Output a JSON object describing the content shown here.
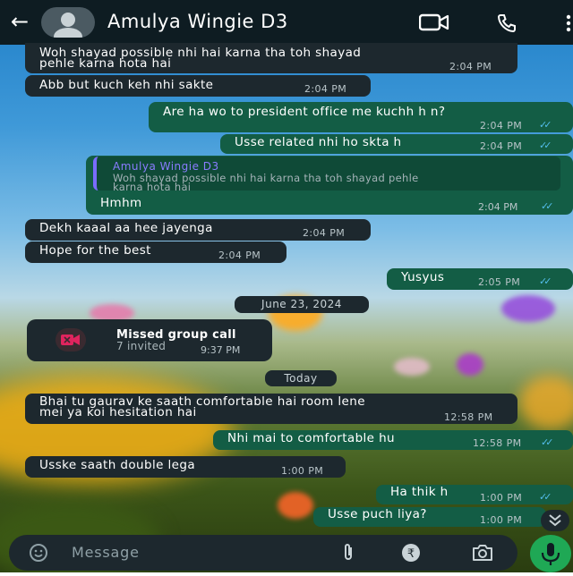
{
  "header": {
    "title": "Amulya Wingie D3",
    "back_icon": "arrow-left-icon",
    "video_icon": "video-call-icon",
    "call_icon": "phone-icon",
    "menu_icon": "more-vert-icon",
    "background": "#0e1c22"
  },
  "colors": {
    "incoming": "#1d282e",
    "outgoing": "#135d45",
    "read_ticks": "#53bdeb",
    "mic": "#1fa855"
  },
  "messages": [
    {
      "dir": "in",
      "text": "Woh shayad possible nhi hai karna tha toh shayad",
      "text2": "pehle karna hota hai",
      "time": "2:04 PM"
    },
    {
      "dir": "in",
      "text": "Abb but kuch keh nhi sakte",
      "time": "2:04 PM"
    },
    {
      "dir": "out",
      "text": "Are ha wo to president office me kuchh h n?",
      "time": "2:04 PM",
      "status": "read"
    },
    {
      "dir": "out",
      "text": "Usse related nhi ho skta h",
      "time": "2:04 PM",
      "status": "read"
    },
    {
      "dir": "out",
      "quote_author": "Amulya Wingie D3",
      "quote_text": "Woh shayad possible nhi hai karna tha toh shayad pehle",
      "quote_text2": "karna hota hai",
      "text": "Hmhm",
      "time": "2:04 PM",
      "status": "read"
    },
    {
      "dir": "in",
      "text": "Dekh kaaal aa hee jayenga",
      "time": "2:04 PM"
    },
    {
      "dir": "in",
      "text": "Hope for the best",
      "time": "2:04 PM"
    },
    {
      "dir": "out",
      "text": "Yusyus",
      "time": "2:05 PM",
      "status": "read"
    },
    {
      "dir": "in",
      "text": "Bhai tu gaurav ke saath comfortable hai room lene",
      "text2": "mei ya koi hesitation hai",
      "time": "12:58 PM"
    },
    {
      "dir": "out",
      "text": "Nhi mai to comfortable hu",
      "time": "12:58 PM",
      "status": "read"
    },
    {
      "dir": "in",
      "text": "Usske saath double lega",
      "time": "1:00 PM"
    },
    {
      "dir": "out",
      "text": "Ha thik h",
      "time": "1:00 PM",
      "status": "read"
    },
    {
      "dir": "out",
      "text": "Usse puch liya?",
      "time": "1:00 PM",
      "status": "read"
    }
  ],
  "dates": {
    "d1": "June 23, 2024",
    "d2": "Today"
  },
  "missed_call": {
    "title": "Missed group call",
    "subtitle": "7 invited",
    "time": "9:37 PM",
    "icon": "missed-video-call-icon"
  },
  "input": {
    "placeholder": "Message",
    "emoji_icon": "emoji-icon",
    "attach_icon": "paperclip-icon",
    "rupee_icon": "rupee-icon",
    "camera_icon": "camera-icon",
    "mic_icon": "mic-icon"
  },
  "scroll_icon": "double-chevron-down-icon"
}
